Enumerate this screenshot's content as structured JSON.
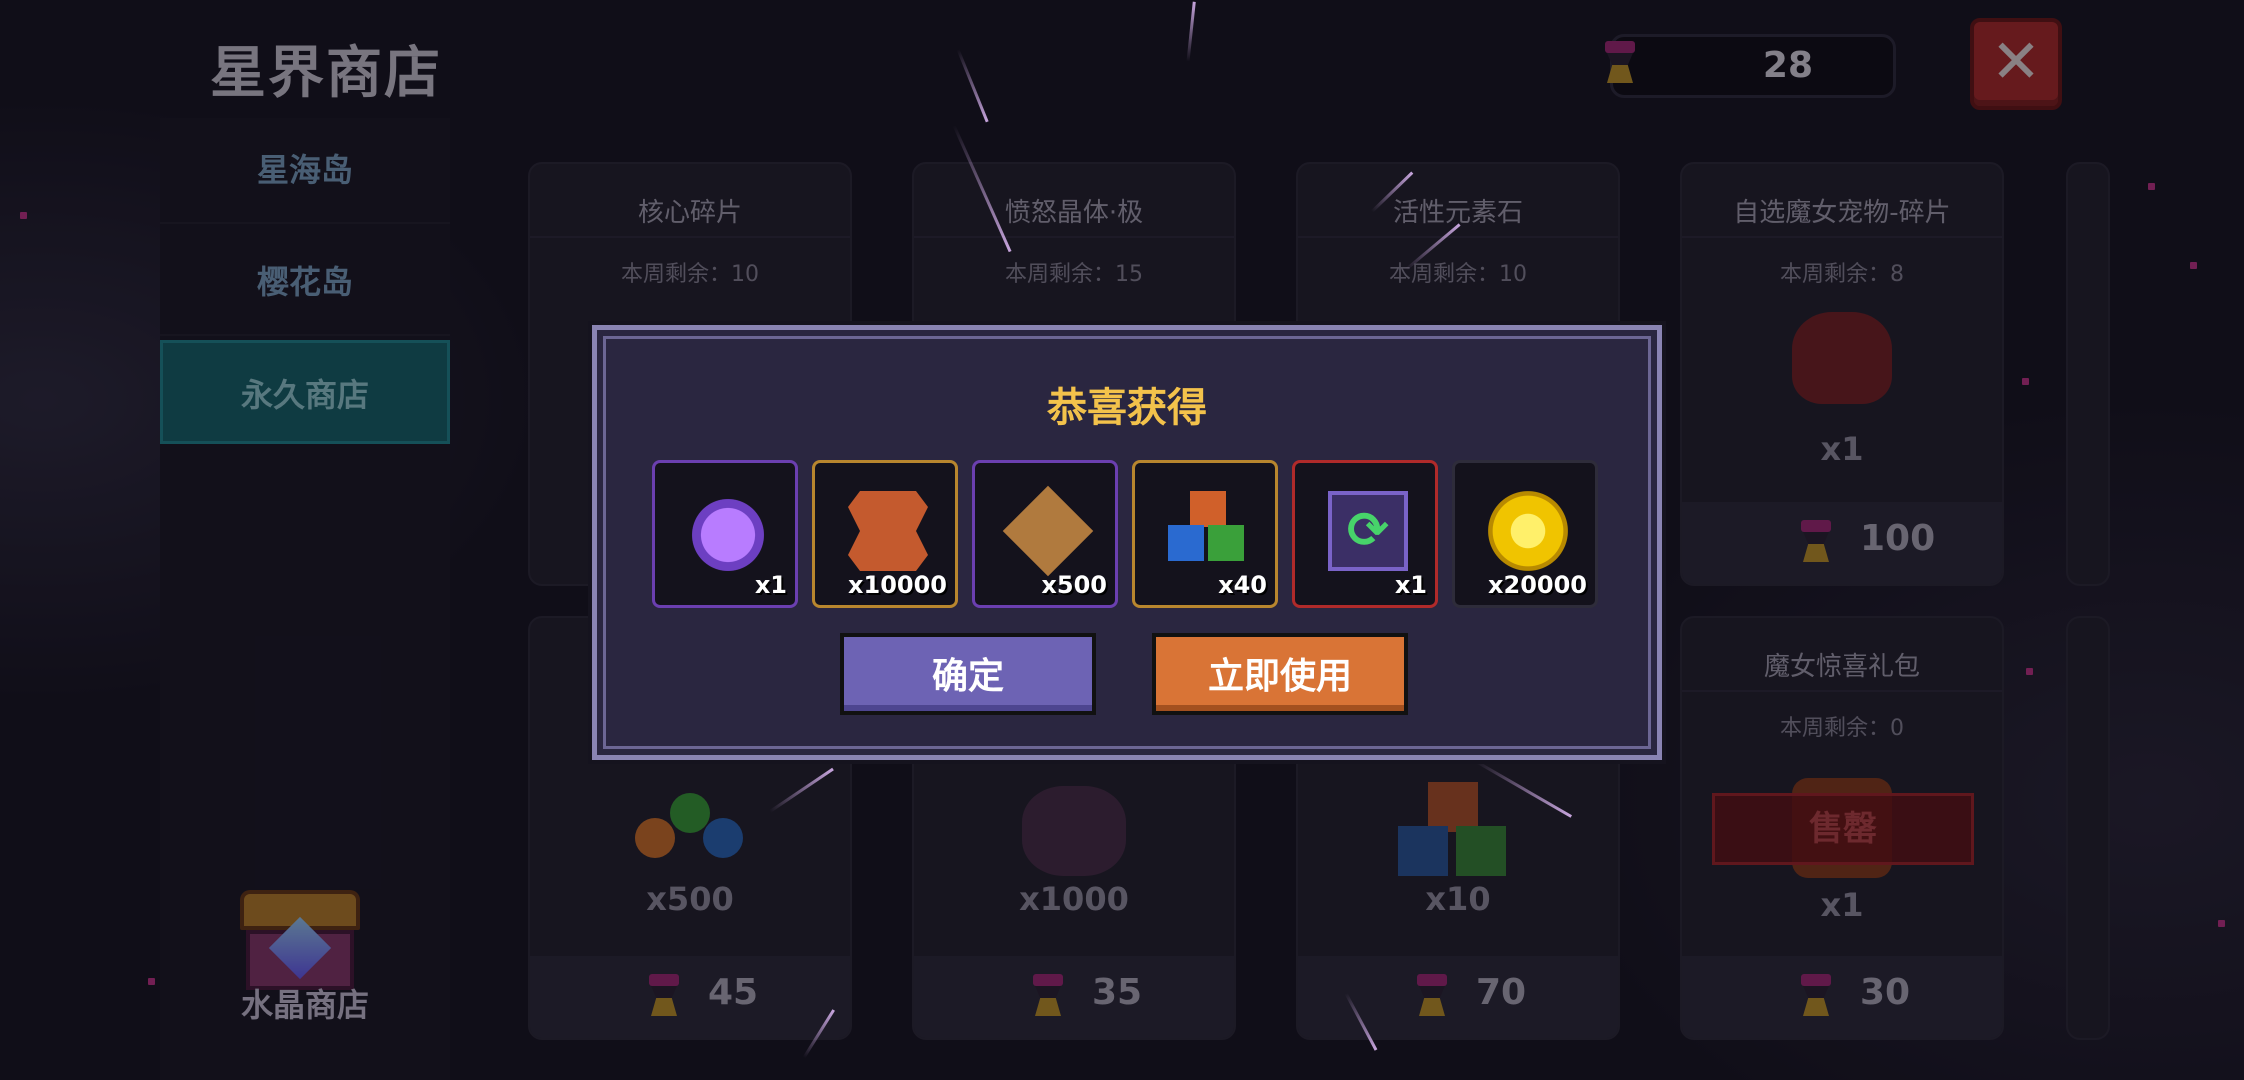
{
  "header": {
    "title": "星界商店",
    "currency_amount": "28",
    "close_label": "✕"
  },
  "sidebar": {
    "items": [
      {
        "label": "星海岛"
      },
      {
        "label": "樱花岛"
      },
      {
        "label": "永久商店"
      }
    ],
    "active_item": "永久商店",
    "crystal_shop_label": "水晶商店"
  },
  "shop": {
    "remaining_prefix": "本周剩余：",
    "cards": [
      {
        "name": "核心碎片",
        "remaining": "本周剩余：10"
      },
      {
        "name": "愤怒晶体·极",
        "remaining": "本周剩余：15"
      },
      {
        "name": "活性元素石",
        "remaining": "本周剩余：10"
      },
      {
        "name": "自选魔女宠物-碎片",
        "remaining": "本周剩余：8",
        "qty": "x1",
        "price": "100"
      },
      {
        "qty": "x500",
        "price": "45"
      },
      {
        "qty": "x1000",
        "price": "35"
      },
      {
        "qty": "x10",
        "price": "70"
      },
      {
        "name": "魔女惊喜礼包",
        "remaining": "本周剩余：0",
        "qty": "x1",
        "price": "30",
        "status": "售罄"
      }
    ]
  },
  "modal": {
    "title": "恭喜获得",
    "rewards": [
      {
        "icon": "mystery-egg-icon",
        "count": "x1",
        "border": "#6b3fb0"
      },
      {
        "icon": "leather-hide-icon",
        "count": "x10000",
        "border": "#b8862e"
      },
      {
        "icon": "bronze-emblem-icon",
        "count": "x500",
        "border": "#6b3fb0"
      },
      {
        "icon": "element-stones-icon",
        "count": "x40",
        "border": "#b8862e"
      },
      {
        "icon": "refresh-card-icon",
        "count": "x1",
        "border": "#b02a2a"
      },
      {
        "icon": "gold-coin-icon",
        "count": "x20000",
        "border": "#2e2c3a"
      }
    ],
    "confirm_label": "确定",
    "use_label": "立即使用"
  }
}
